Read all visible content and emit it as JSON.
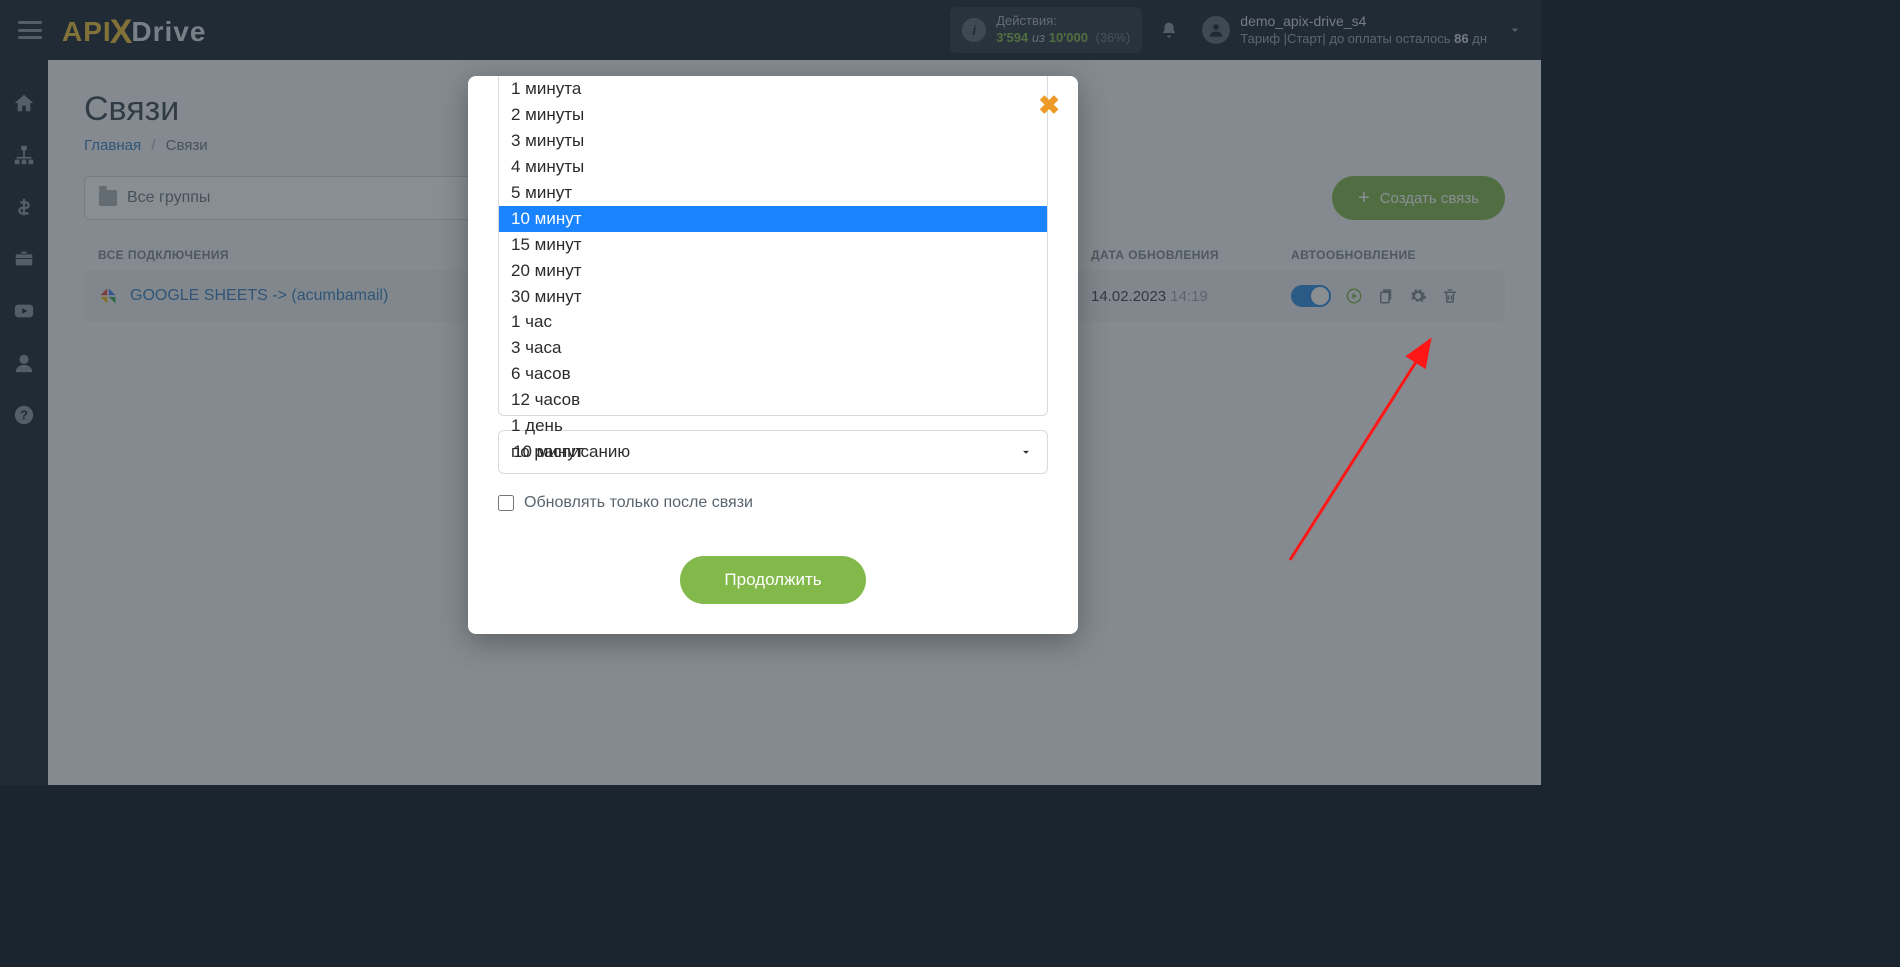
{
  "header": {
    "logo_api": "API",
    "logo_drive": "Drive",
    "actions_label": "Действия:",
    "actions_current": "3'594",
    "actions_of": "из",
    "actions_total": "10'000",
    "actions_pct": "(36%)",
    "username": "demo_apix-drive_s4",
    "tariff_prefix": "Тариф |Старт| до оплаты осталось",
    "days": "86",
    "days_suffix": "дн"
  },
  "page": {
    "title": "Связи",
    "crumb_home": "Главная",
    "crumb_current": "Связи",
    "group_select": "Все группы",
    "create_btn": "Создать связь"
  },
  "table": {
    "col_name": "ВСЕ ПОДКЛЮЧЕНИЯ",
    "col_date": "ДАТА ОБНОВЛЕНИЯ",
    "col_auto": "АВТООБНОВЛЕНИЕ",
    "rows": [
      {
        "name": "GOOGLE SHEETS -> (acumbamail)",
        "date": "14.02.2023",
        "time": "14:19"
      }
    ]
  },
  "modal": {
    "options": [
      "1 минута",
      "2 минуты",
      "3 минуты",
      "4 минуты",
      "5 минут",
      "10 минут",
      "15 минут",
      "20 минут",
      "30 минут",
      "1 час",
      "3 часа",
      "6 часов",
      "12 часов",
      "1 день",
      "по расписанию"
    ],
    "selected_index": 5,
    "selected_value": "10 минут",
    "checkbox_label": "Обновлять только после связи",
    "continue": "Продолжить"
  }
}
